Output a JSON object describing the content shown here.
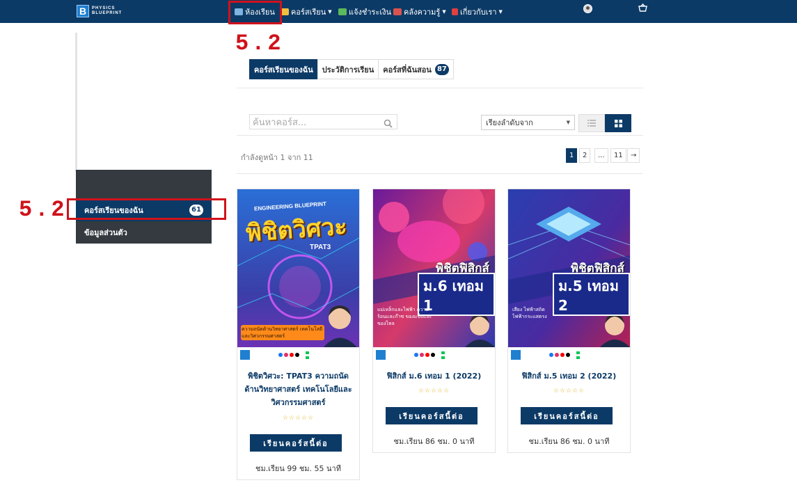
{
  "nav": {
    "logo_letter": "B",
    "logo_line1": "PHYSICS",
    "logo_line2": "BLUEPRINT",
    "items": [
      {
        "label": "ห้องเรียน",
        "caret": false
      },
      {
        "label": "คอร์สเรียน",
        "caret": true
      },
      {
        "label": "แจ้งชำระเงิน",
        "caret": false
      },
      {
        "label": "คลังความรู้",
        "caret": true
      },
      {
        "label": "เกี่ยวกับเรา",
        "caret": true
      }
    ]
  },
  "annotations": {
    "top": "5.2",
    "side": "5.2"
  },
  "sidebar": {
    "items": [
      {
        "label": "คอร์สเรียนของฉัน",
        "badge": "61"
      },
      {
        "label": "ข้อมูลส่วนตัว"
      }
    ]
  },
  "tabs": [
    {
      "label": "คอร์สเรียนของฉัน"
    },
    {
      "label": "ประวัติการเรียน"
    },
    {
      "label": "คอร์สที่ฉันสอน",
      "badge": "87"
    }
  ],
  "search": {
    "placeholder": "ค้นหาคอร์ส..."
  },
  "sort": {
    "label": "เรียงลำดับจาก"
  },
  "pagination": {
    "info": "กำลังดูหน้า 1 จาก 11",
    "pages": [
      "1",
      "2",
      "...",
      "11",
      "→"
    ],
    "current": "1"
  },
  "courses": [
    {
      "title": "พิชิตวิศวะ: TPAT3 ความถนัดด้านวิทยาศาสตร์ เทคโนโลยีและวิศวกรรมศาสตร์",
      "image_tag": "ENGINEERING BLUEPRINT",
      "image_title": "พิชิตวิศวะ",
      "image_sub": "TPAT3",
      "image_caption": "ความถนัดด้านวิทยาศาสตร์ เทคโนโลยี และวิศวกรรมศาสตร์",
      "button": "เรียนคอร์สนี้ต่อ",
      "hours": "ชม.เรียน 99 ชม. 55 นาที"
    },
    {
      "title": "ฟิสิกส์ ม.6 เทอม 1 (2022)",
      "image_title": "พิชิตฟิสิกส์",
      "image_sub": "ม.6 เทอม 1",
      "image_caption": "แม่เหล็กและไฟฟ้า ความร้อนและก๊าซ ของแข็งและของไหล",
      "button": "เรียนคอร์สนี้ต่อ",
      "hours": "ชม.เรียน 86 ชม. 0 นาที"
    },
    {
      "title": "ฟิสิกส์ ม.5 เทอม 2 (2022)",
      "image_title": "พิชิตฟิสิกส์",
      "image_sub": "ม.5 เทอม 2",
      "image_caption": "เสียง ไฟฟ้าสถิต ไฟฟ้ากระแสตรง",
      "button": "เรียนคอร์สนี้ต่อ",
      "hours": "ชม.เรียน 86 ชม. 0 นาที"
    }
  ],
  "stars": "☆☆☆☆☆",
  "colors": {
    "navy": "#0c3a66",
    "red_annotation": "#d0121b",
    "sidebar_dark": "#343a3f",
    "star": "#e0b020"
  }
}
